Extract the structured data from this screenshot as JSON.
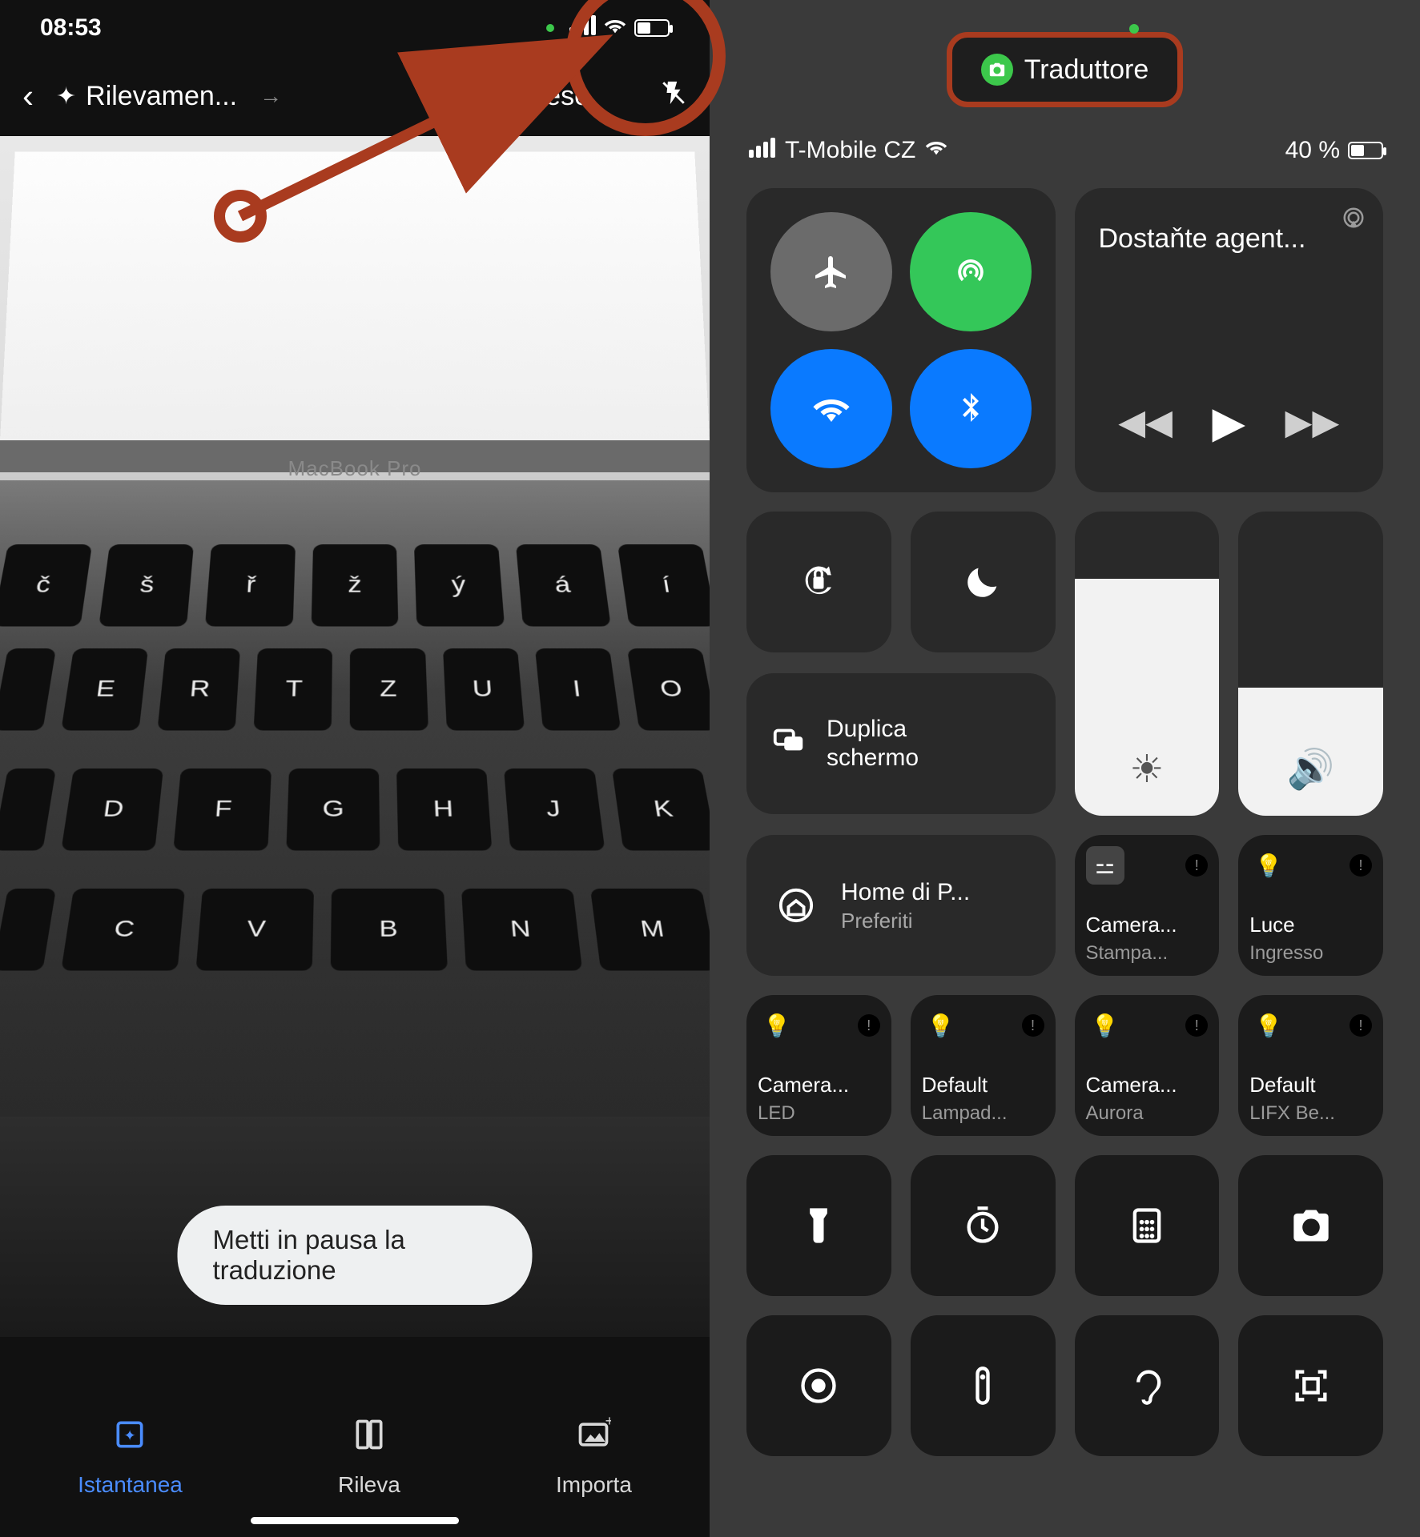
{
  "left": {
    "status": {
      "time": "08:53"
    },
    "lang": {
      "source": "Rilevamen...",
      "target": "Inglese"
    },
    "photo": {
      "label": "MacBook Pro",
      "row_tiny": [
        "č",
        "š",
        "ř",
        "ž",
        "ý",
        "á",
        "í"
      ],
      "row1": [
        "E",
        "R",
        "T",
        "Z",
        "U",
        "I",
        "O"
      ],
      "row2": [
        "D",
        "F",
        "G",
        "H",
        "J",
        "K"
      ],
      "row3": [
        "C",
        "V",
        "B",
        "N",
        "M"
      ]
    },
    "pause": "Metti in pausa la traduzione",
    "nav": {
      "instant": "Istantanea",
      "scan": "Rileva",
      "import": "Importa"
    }
  },
  "right": {
    "pill": "Traduttore",
    "carrier": "T-Mobile CZ",
    "battery_pct": "40 %",
    "media_title": "Dostaňte agent...",
    "mirror": {
      "l1": "Duplica",
      "l2": "schermo"
    },
    "home": {
      "title": "Home di P...",
      "sub": "Preferiti"
    },
    "hk": [
      {
        "name": "Camera...",
        "sub": "Stampa...",
        "icon": "plug"
      },
      {
        "name": "Luce",
        "sub": "Ingresso",
        "icon": "bulb"
      },
      {
        "name": "Camera...",
        "sub": "LED",
        "icon": "bulb"
      },
      {
        "name": "Default",
        "sub": "Lampad...",
        "icon": "bulb"
      },
      {
        "name": "Camera...",
        "sub": "Aurora",
        "icon": "bulb"
      },
      {
        "name": "Default",
        "sub": "LIFX Be...",
        "icon": "bulb"
      }
    ],
    "brightness_pct": 78,
    "volume_pct": 42
  }
}
